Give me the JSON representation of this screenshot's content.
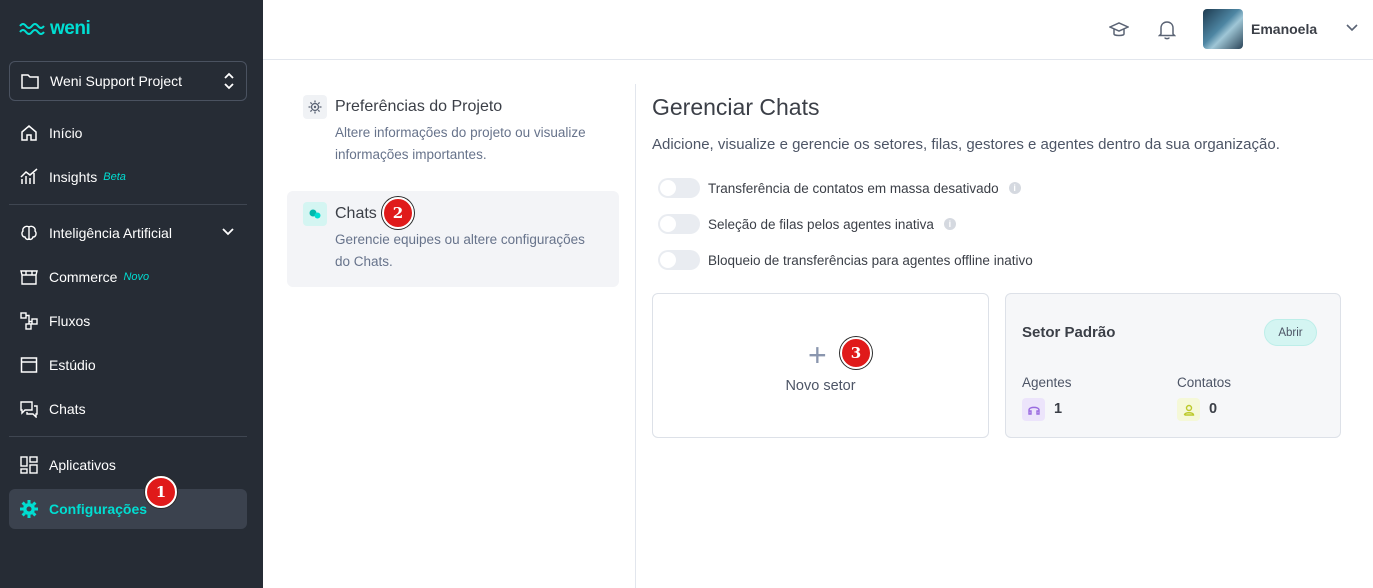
{
  "sidebar": {
    "logo": "weni",
    "project": "Weni Support Project",
    "items": [
      {
        "label": "Início",
        "icon": "home-icon"
      },
      {
        "label": "Insights",
        "tag": "Beta",
        "icon": "chart-icon"
      },
      {
        "label": "Inteligência Artificial",
        "icon": "brain-icon"
      },
      {
        "label": "Commerce",
        "tag": "Novo",
        "icon": "store-icon"
      },
      {
        "label": "Fluxos",
        "icon": "flows-icon"
      },
      {
        "label": "Estúdio",
        "icon": "window-icon"
      },
      {
        "label": "Chats",
        "icon": "chat-icon"
      },
      {
        "label": "Aplicativos",
        "icon": "apps-icon"
      },
      {
        "label": "Configurações",
        "icon": "gear-icon"
      }
    ]
  },
  "header": {
    "user_name": "Emanoela"
  },
  "settings_menu": [
    {
      "title": "Preferências do Projeto",
      "desc": "Altere informações do projeto ou visualize informações importantes."
    },
    {
      "title": "Chats",
      "desc": "Gerencie equipes ou altere configurações do Chats."
    }
  ],
  "main": {
    "title": "Gerenciar Chats",
    "subtitle": "Adicione, visualize e gerencie os setores, filas, gestores e agentes dentro da sua organização.",
    "toggles": [
      "Transferência de contatos em massa desativado",
      "Seleção de filas pelos agentes inativa",
      "Bloqueio de transferências para agentes offline inativo"
    ],
    "new_sector": "Novo setor",
    "sector": {
      "name": "Setor Padrão",
      "open_label": "Abrir",
      "agents_label": "Agentes",
      "agents_count": "1",
      "contacts_label": "Contatos",
      "contacts_count": "0"
    }
  },
  "markers": [
    "1",
    "2",
    "3"
  ],
  "colors": {
    "sidebar_bg": "#262c35",
    "accent": "#00ded2",
    "marker": "#e01a1a"
  }
}
